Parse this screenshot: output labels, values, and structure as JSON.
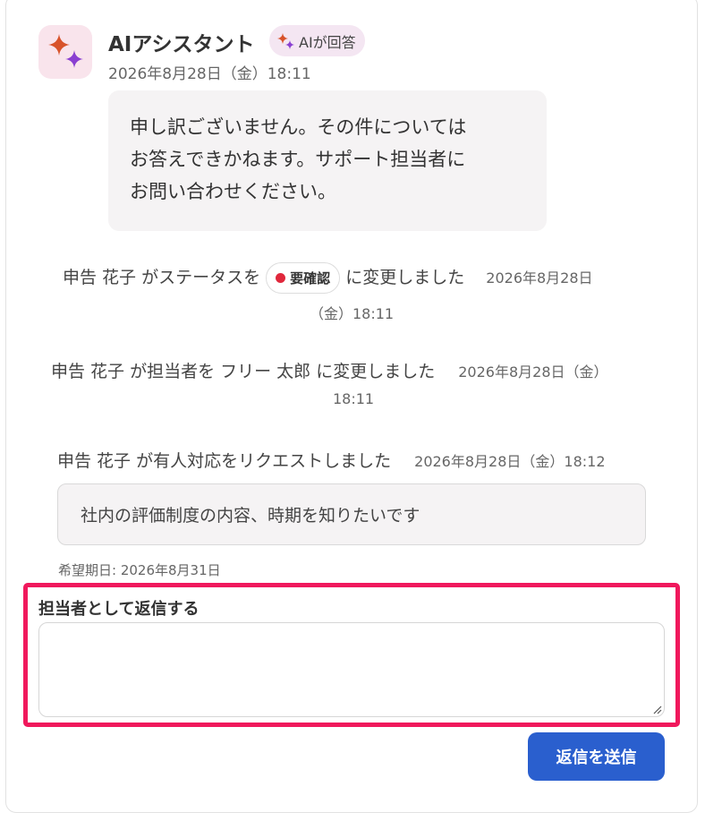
{
  "message": {
    "sender": "AIアシスタント",
    "badge": "AIが回答",
    "timestamp": "2026年8月28日（金）18:11",
    "lines": [
      "申し訳ございません。その件については",
      "お答えできかねます。サポート担当者に",
      "お問い合わせください。"
    ]
  },
  "activities": {
    "status_change": {
      "actor": "申告 花子",
      "text_before": "がステータスを",
      "status": "要確認",
      "status_color": "#e0283c",
      "text_after": "に変更しました",
      "time_part1": "2026年8月28日",
      "time_part2": "（金）18:11"
    },
    "assignee_change": {
      "text": "申告 花子 が担当者を フリー 太郎 に変更しました",
      "time_part1": "2026年8月28日（金）",
      "time_part2": "18:11"
    },
    "human_request": {
      "text": "申告 花子 が有人対応をリクエストしました",
      "time": "2026年8月28日（金）18:12",
      "request_text": "社内の評価制度の内容、時期を知りたいです",
      "desired_date": "希望期日: 2026年8月31日"
    }
  },
  "reply": {
    "label": "担当者として返信する",
    "value": "",
    "send_label": "返信を送信",
    "highlight_color": "#f0185c"
  },
  "colors": {
    "accent": "#2a5fce",
    "sparkle_orange": "#d8532b",
    "sparkle_purple": "#8a3fd1"
  }
}
